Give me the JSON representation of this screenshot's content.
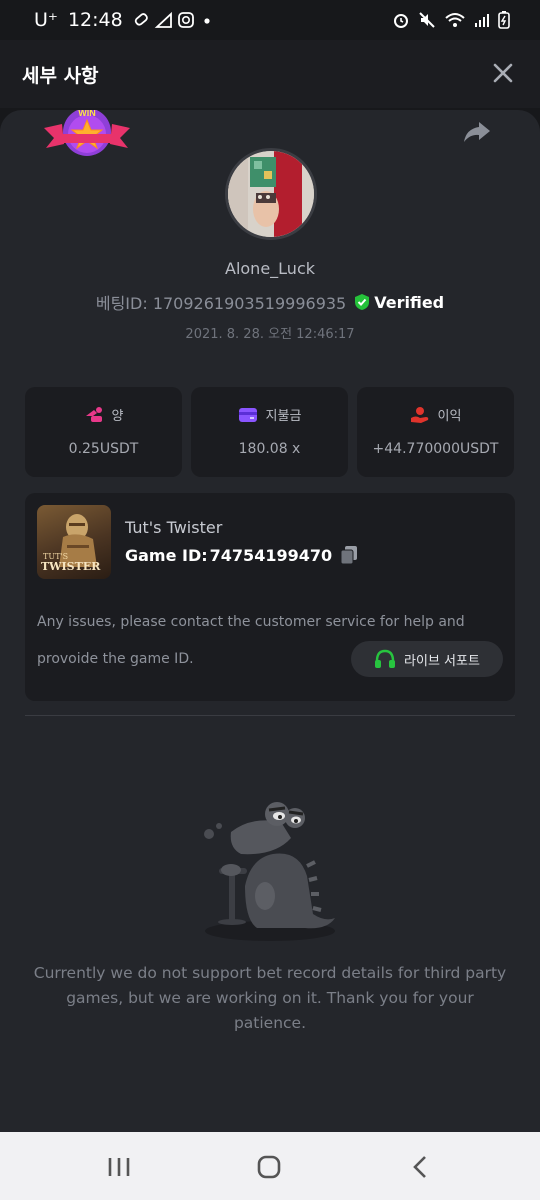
{
  "status_bar": {
    "carrier": "U⁺",
    "time": "12:48"
  },
  "header": {
    "title": "세부 사항"
  },
  "win_badge": {
    "text": "WIN"
  },
  "profile": {
    "username": "Alone_Luck",
    "bet_id": "베팅ID: 1709261903519996935",
    "verified_label": "Verified",
    "datetime": "2021. 8. 28. 오전 12:46:17"
  },
  "stats": [
    {
      "label": "양",
      "value": "0.25USDT",
      "icon": "coins-icon",
      "color": "#e8388a"
    },
    {
      "label": "지불금",
      "value": "180.08 x",
      "icon": "card-icon",
      "color": "#8a55ff"
    },
    {
      "label": "이익",
      "value": "+44.770000USDT",
      "icon": "hand-coin-icon",
      "color": "#e0342c"
    }
  ],
  "game": {
    "name": "Tut's Twister",
    "id_label": "Game ID:",
    "id_value": "74754199470",
    "thumb_line1": "TUT'S",
    "thumb_line2": "TWISTER",
    "notice_line1": "Any issues, please contact the customer service for help and",
    "notice_line2": "provoide the game ID.",
    "support_label": "라이브 서포트"
  },
  "empty_state": {
    "message": "Currently we do not support bet record details for third party games, but we are working on it. Thank you for your patience."
  },
  "colors": {
    "verified": "#25c13a",
    "headset": "#27c43f",
    "background": "#24262b"
  }
}
